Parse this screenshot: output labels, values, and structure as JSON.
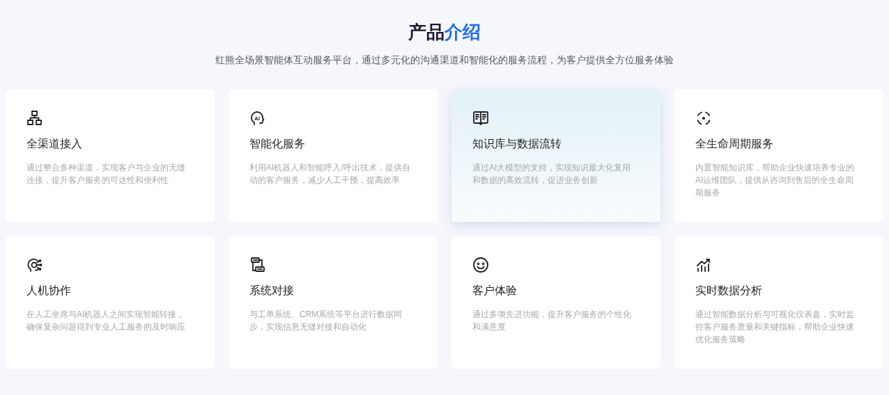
{
  "header": {
    "title": "产品",
    "title_accent": "介绍",
    "subtitle": "红熊全场景智能体互动服务平台，通过多元化的沟通渠道和智能化的服务流程，为客户提供全方位服务体验"
  },
  "cards": [
    {
      "title": "全渠道接入",
      "description": "通过整合多种渠道，实现客户与企业的无缝连接，提升客户服务的可达性和便利性",
      "highlighted": false
    },
    {
      "title": "智能化服务",
      "icon_label": "AI",
      "description": "利用AI机器人和智能呼入/呼出技术，提供自动的客户服务，减少人工干预，提高效率",
      "highlighted": false
    },
    {
      "title": "知识库与数据流转",
      "description": "通过AI大模型的支持，实现知识最大化复用和数据的高效流转，促进业务创新",
      "highlighted": true
    },
    {
      "title": "全生命周期服务",
      "description": "内置智能知识库，帮助企业快速培养专业的AI运维团队，提供从咨询到售后的全生命周期服务",
      "highlighted": false
    },
    {
      "title": "人机协作",
      "description": "在人工坐席与AI机器人之间实现智能转接，确保复杂问题得到专业人工服务的及时响应",
      "highlighted": false
    },
    {
      "title": "系统对接",
      "description": "与工单系统、CRM系统等平台进行数据同步，实现信息无缝对接和自动化",
      "highlighted": false
    },
    {
      "title": "客户体验",
      "description": "通过多项先进功能，提升客户服务的个性化和满意度",
      "highlighted": false
    },
    {
      "title": "实时数据分析",
      "description": "通过智能数据分析与可视化仪表盘，实时监控客户服务质量和关键指标，帮助企业快速优化服务策略",
      "highlighted": false
    }
  ]
}
